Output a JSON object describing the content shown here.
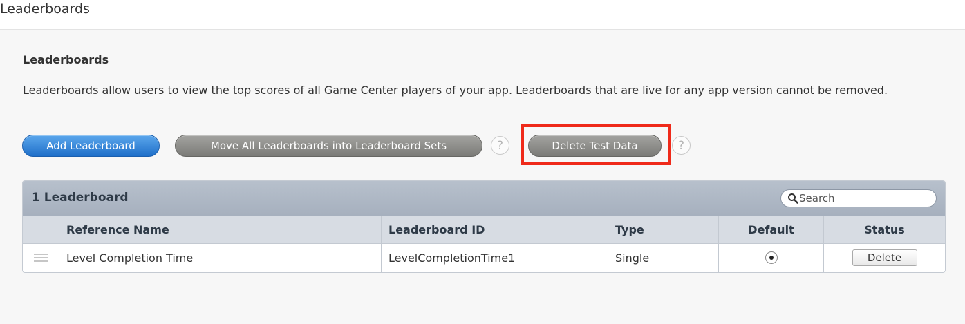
{
  "page": {
    "heading": "Leaderboards"
  },
  "section": {
    "title": "Leaderboards",
    "description": "Leaderboards allow users to view the top scores of all Game Center players of your app. Leaderboards that are live for any app version cannot be removed."
  },
  "actions": {
    "add_label": "Add Leaderboard",
    "move_label": "Move All Leaderboards into Leaderboard Sets",
    "delete_test_label": "Delete Test Data",
    "help_glyph": "?"
  },
  "table": {
    "count_label": "1 Leaderboard",
    "search_placeholder": "Search",
    "columns": [
      "Reference Name",
      "Leaderboard ID",
      "Type",
      "Default",
      "Status"
    ],
    "rows": [
      {
        "reference_name": "Level Completion Time",
        "leaderboard_id": "LevelCompletionTime1",
        "type": "Single",
        "default_selected": true,
        "status_button": "Delete"
      }
    ]
  },
  "icons": {
    "search": "search-icon",
    "help": "help-icon",
    "drag": "drag-handle-icon",
    "radio": "radio-selected-icon"
  },
  "colors": {
    "primary_button": "#2f80d8",
    "secondary_button": "#8e8e8b",
    "highlight": "#ef2a1a",
    "table_toolbar": "#aeb7c4"
  }
}
